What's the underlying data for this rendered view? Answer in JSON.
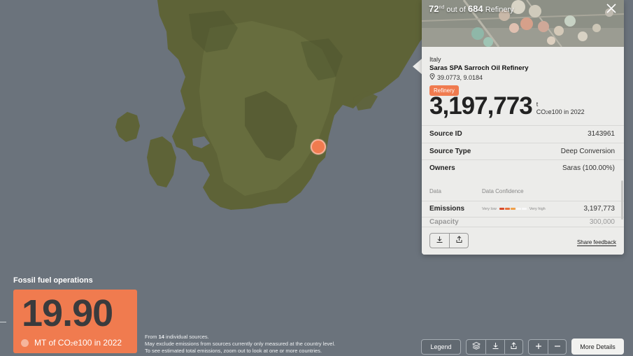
{
  "panel": {
    "rank_num": "72",
    "rank_suffix": "nd",
    "rank_mid": "out of",
    "rank_total": "684",
    "rank_type": "Refinery",
    "country": "Italy",
    "facility": "Saras SPA Sarroch Oil Refinery",
    "coords": "39.0773, 9.0184",
    "badge": "Refinery",
    "emissions_total": "3,197,773",
    "unit_t": "t",
    "unit_co2": "CO",
    "unit_sub": "2",
    "unit_rest": "e100 in 2022",
    "rows": [
      {
        "key": "Source ID",
        "value": "3143961"
      },
      {
        "key": "Source Type",
        "value": "Deep Conversion"
      },
      {
        "key": "Owners",
        "value": "Saras (100.00%)"
      }
    ],
    "data_header": "Data",
    "conf_header": "Data Confidence",
    "emissions_label": "Emissions",
    "very_low": "Very low",
    "very_high": "Very high",
    "emissions_value": "3,197,773",
    "conf_colors": [
      "#d94b2b",
      "#e8703a",
      "#f0a04a",
      "#f6f6f6",
      "#f6f6f6"
    ],
    "partial_label": "Capacity",
    "partial_value": "300,000",
    "share_label": "Share feedback"
  },
  "summary": {
    "title": "Fossil fuel operations",
    "value": "19.90",
    "unit_a": "MT of CO",
    "unit_sub": "2",
    "unit_b": "e100 in 2022"
  },
  "note": {
    "line1_a": "From ",
    "line1_b": "14",
    "line1_c": " individual sources.",
    "line2": "May exclude emissions from sources currently only measured at the country level.",
    "line3": "To see estimated total emissions, zoom out to look at one or more countries."
  },
  "toolbar": {
    "legend": "Legend",
    "more_details": "More Details"
  },
  "colors": {
    "accent": "#f07b4f",
    "map_sea": "#6b737c",
    "map_land": "#5c6137"
  }
}
